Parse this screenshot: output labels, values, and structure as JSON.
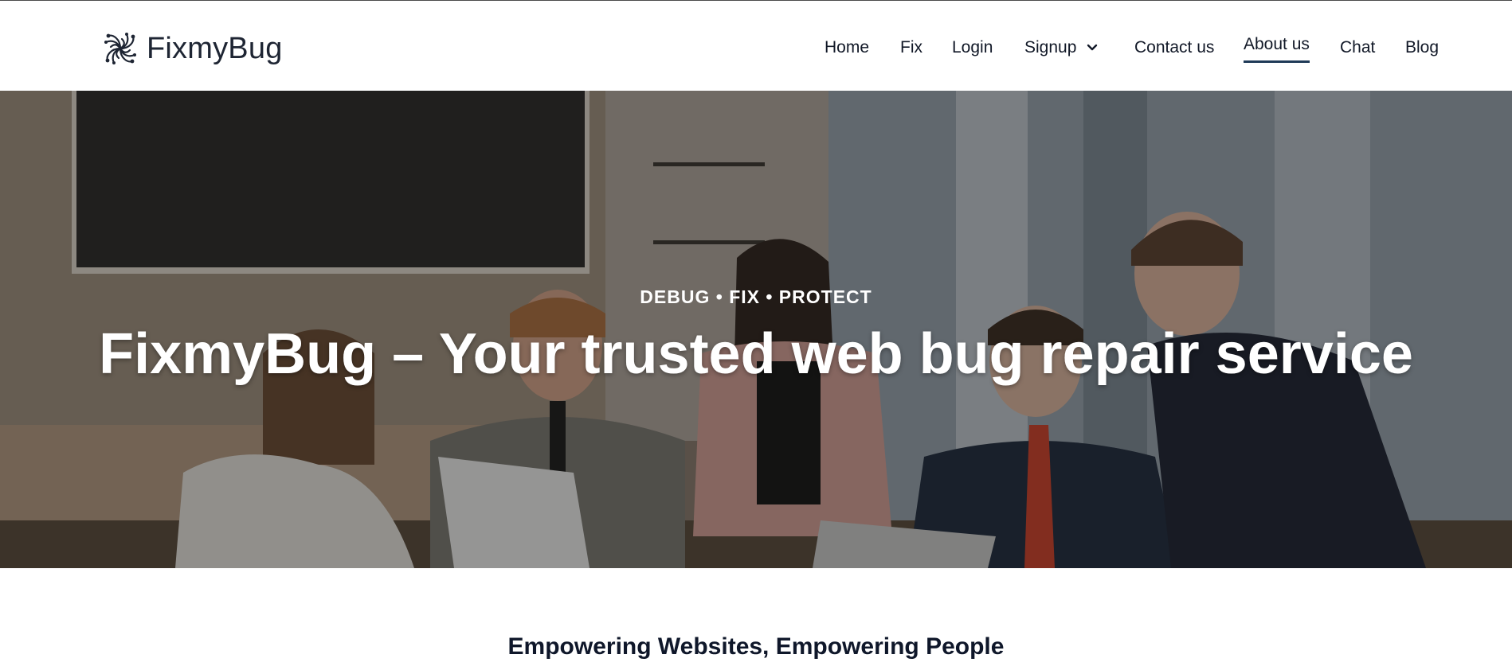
{
  "brand": {
    "name": "FixmyBug"
  },
  "nav": {
    "items": [
      {
        "label": "Home"
      },
      {
        "label": "Fix"
      },
      {
        "label": "Login"
      },
      {
        "label": "Signup",
        "has_dropdown": true
      },
      {
        "label": "Contact us"
      },
      {
        "label": "About us",
        "active": true
      },
      {
        "label": "Chat"
      },
      {
        "label": "Blog"
      }
    ]
  },
  "hero": {
    "eyebrow": "DEBUG • FIX • PROTECT",
    "title": "FixmyBug – Your trusted web bug repair service",
    "image_alt": "team-meeting-photo"
  },
  "section": {
    "title": "Empowering Websites, Empowering People"
  },
  "colors": {
    "active_underline": "#1f3a57",
    "text": "#0f172a",
    "hero_text": "#ffffff"
  },
  "icons": {
    "logo": "circuit-knot-logo-icon",
    "dropdown": "chevron-down-icon"
  }
}
